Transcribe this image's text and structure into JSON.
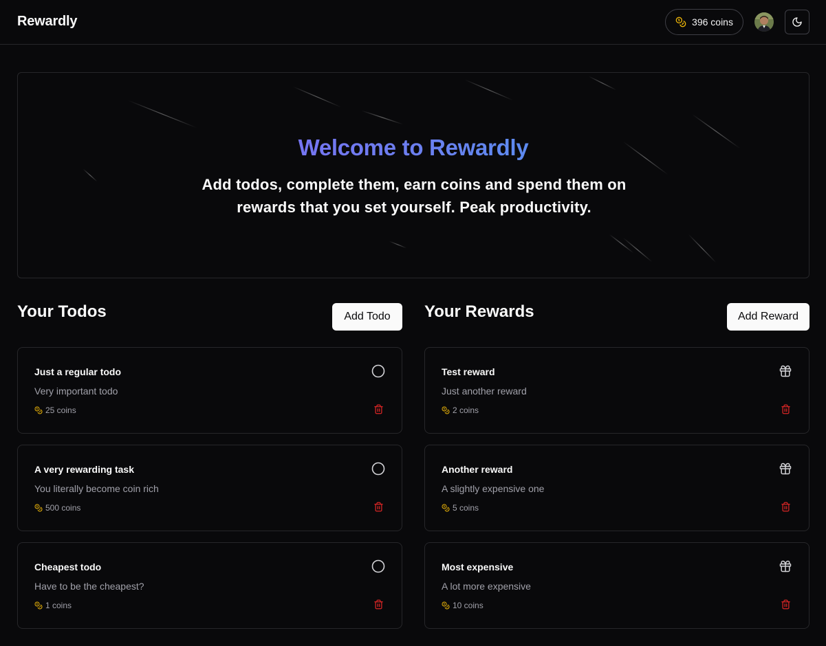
{
  "app": {
    "brand": "Rewardly"
  },
  "header": {
    "coin_balance": "396 coins",
    "avatar_alt": "User avatar",
    "theme_toggle_icon": "moon-icon"
  },
  "hero": {
    "title": "Welcome to Rewardly",
    "subtitle": "Add todos, complete them, earn coins and spend them on rewards that you set yourself. Peak productivity."
  },
  "todos": {
    "heading": "Your Todos",
    "add_label": "Add Todo",
    "items": [
      {
        "title": "Just a regular todo",
        "description": "Very important todo",
        "coins": "25 coins"
      },
      {
        "title": "A very rewarding task",
        "description": "You literally become coin rich",
        "coins": "500 coins"
      },
      {
        "title": "Cheapest todo",
        "description": "Have to be the cheapest?",
        "coins": "1 coins"
      }
    ]
  },
  "rewards": {
    "heading": "Your Rewards",
    "add_label": "Add Reward",
    "items": [
      {
        "title": "Test reward",
        "description": "Just another reward",
        "coins": "2 coins"
      },
      {
        "title": "Another reward",
        "description": "A slightly expensive one",
        "coins": "5 coins"
      },
      {
        "title": "Most expensive",
        "description": "A lot more expensive",
        "coins": "10 coins"
      }
    ]
  },
  "colors": {
    "background": "#09090b",
    "border": "#27272a",
    "coin_accent": "#eab308",
    "delete_accent": "#dc2626",
    "gradient_start": "#8b5cf6",
    "gradient_end": "#38a8f0"
  }
}
